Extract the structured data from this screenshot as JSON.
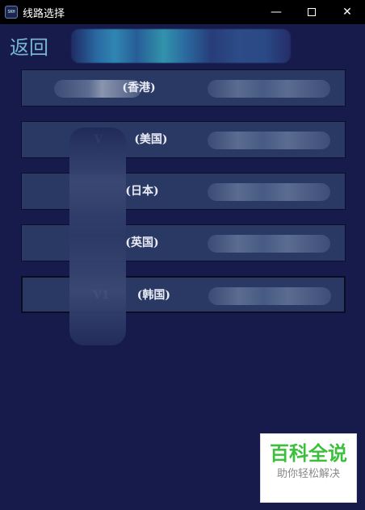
{
  "window": {
    "title": "线路选择",
    "icon": "skh-app-icon",
    "minimize_glyph": "—",
    "close_glyph": "✕"
  },
  "header": {
    "back_label": "返回"
  },
  "routes": [
    {
      "label": "(香港)",
      "prefix": ""
    },
    {
      "label": "(美国)",
      "prefix": "V"
    },
    {
      "label": "(日本)",
      "prefix": ""
    },
    {
      "label": "(英国)",
      "prefix": ""
    },
    {
      "label": "(韩国)",
      "prefix": "V1"
    }
  ],
  "watermark": {
    "main": "百科全说",
    "sub": "助你轻松解决"
  },
  "colors": {
    "background": "#171b4c",
    "route_bg": "#2a3963",
    "back_text": "#76b5d4",
    "watermark_green": "#3cc03c"
  }
}
